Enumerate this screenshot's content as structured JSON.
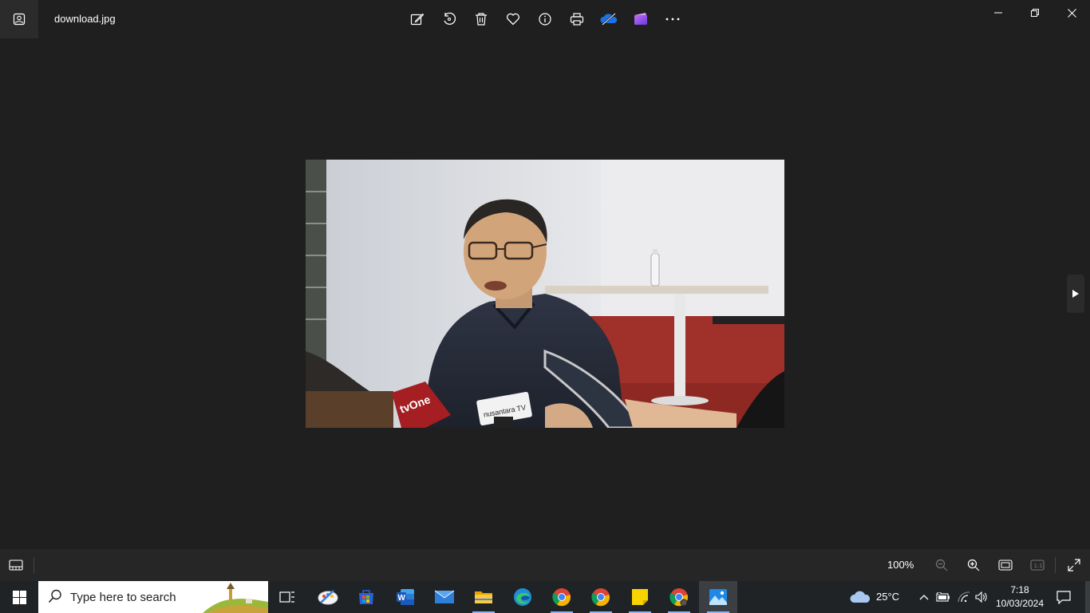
{
  "window": {
    "file_name": "download.jpg",
    "toolbar_icons": [
      "edit-icon",
      "rotate-icon",
      "delete-icon",
      "favorite-icon",
      "info-icon",
      "print-icon",
      "onedrive-icon",
      "clipchamp-icon",
      "more-icon"
    ],
    "controls": [
      "minimize",
      "restore",
      "close"
    ]
  },
  "photo": {
    "description_visible": false,
    "mic_labels": [
      "tvOne",
      "nusantara TV"
    ]
  },
  "bottom_bar": {
    "zoom_level": "100%",
    "tools": [
      "zoom-out-icon",
      "zoom-in-icon",
      "fit-to-window-icon",
      "actual-size-icon",
      "full-screen-icon"
    ]
  },
  "taskbar": {
    "search_placeholder": "Type here to search",
    "apps": [
      "task-view",
      "paint-3d",
      "microsoft-store",
      "word",
      "mail",
      "file-explorer",
      "edge",
      "chrome",
      "chrome",
      "sticky-notes",
      "chrome",
      "photos"
    ],
    "weather": {
      "temp": "25°C",
      "icon": "cloud-icon"
    },
    "clock": {
      "time": "7:18",
      "date": "10/03/2024"
    }
  },
  "colors": {
    "background": "#1f1f1f",
    "accent": "#0078d4"
  }
}
